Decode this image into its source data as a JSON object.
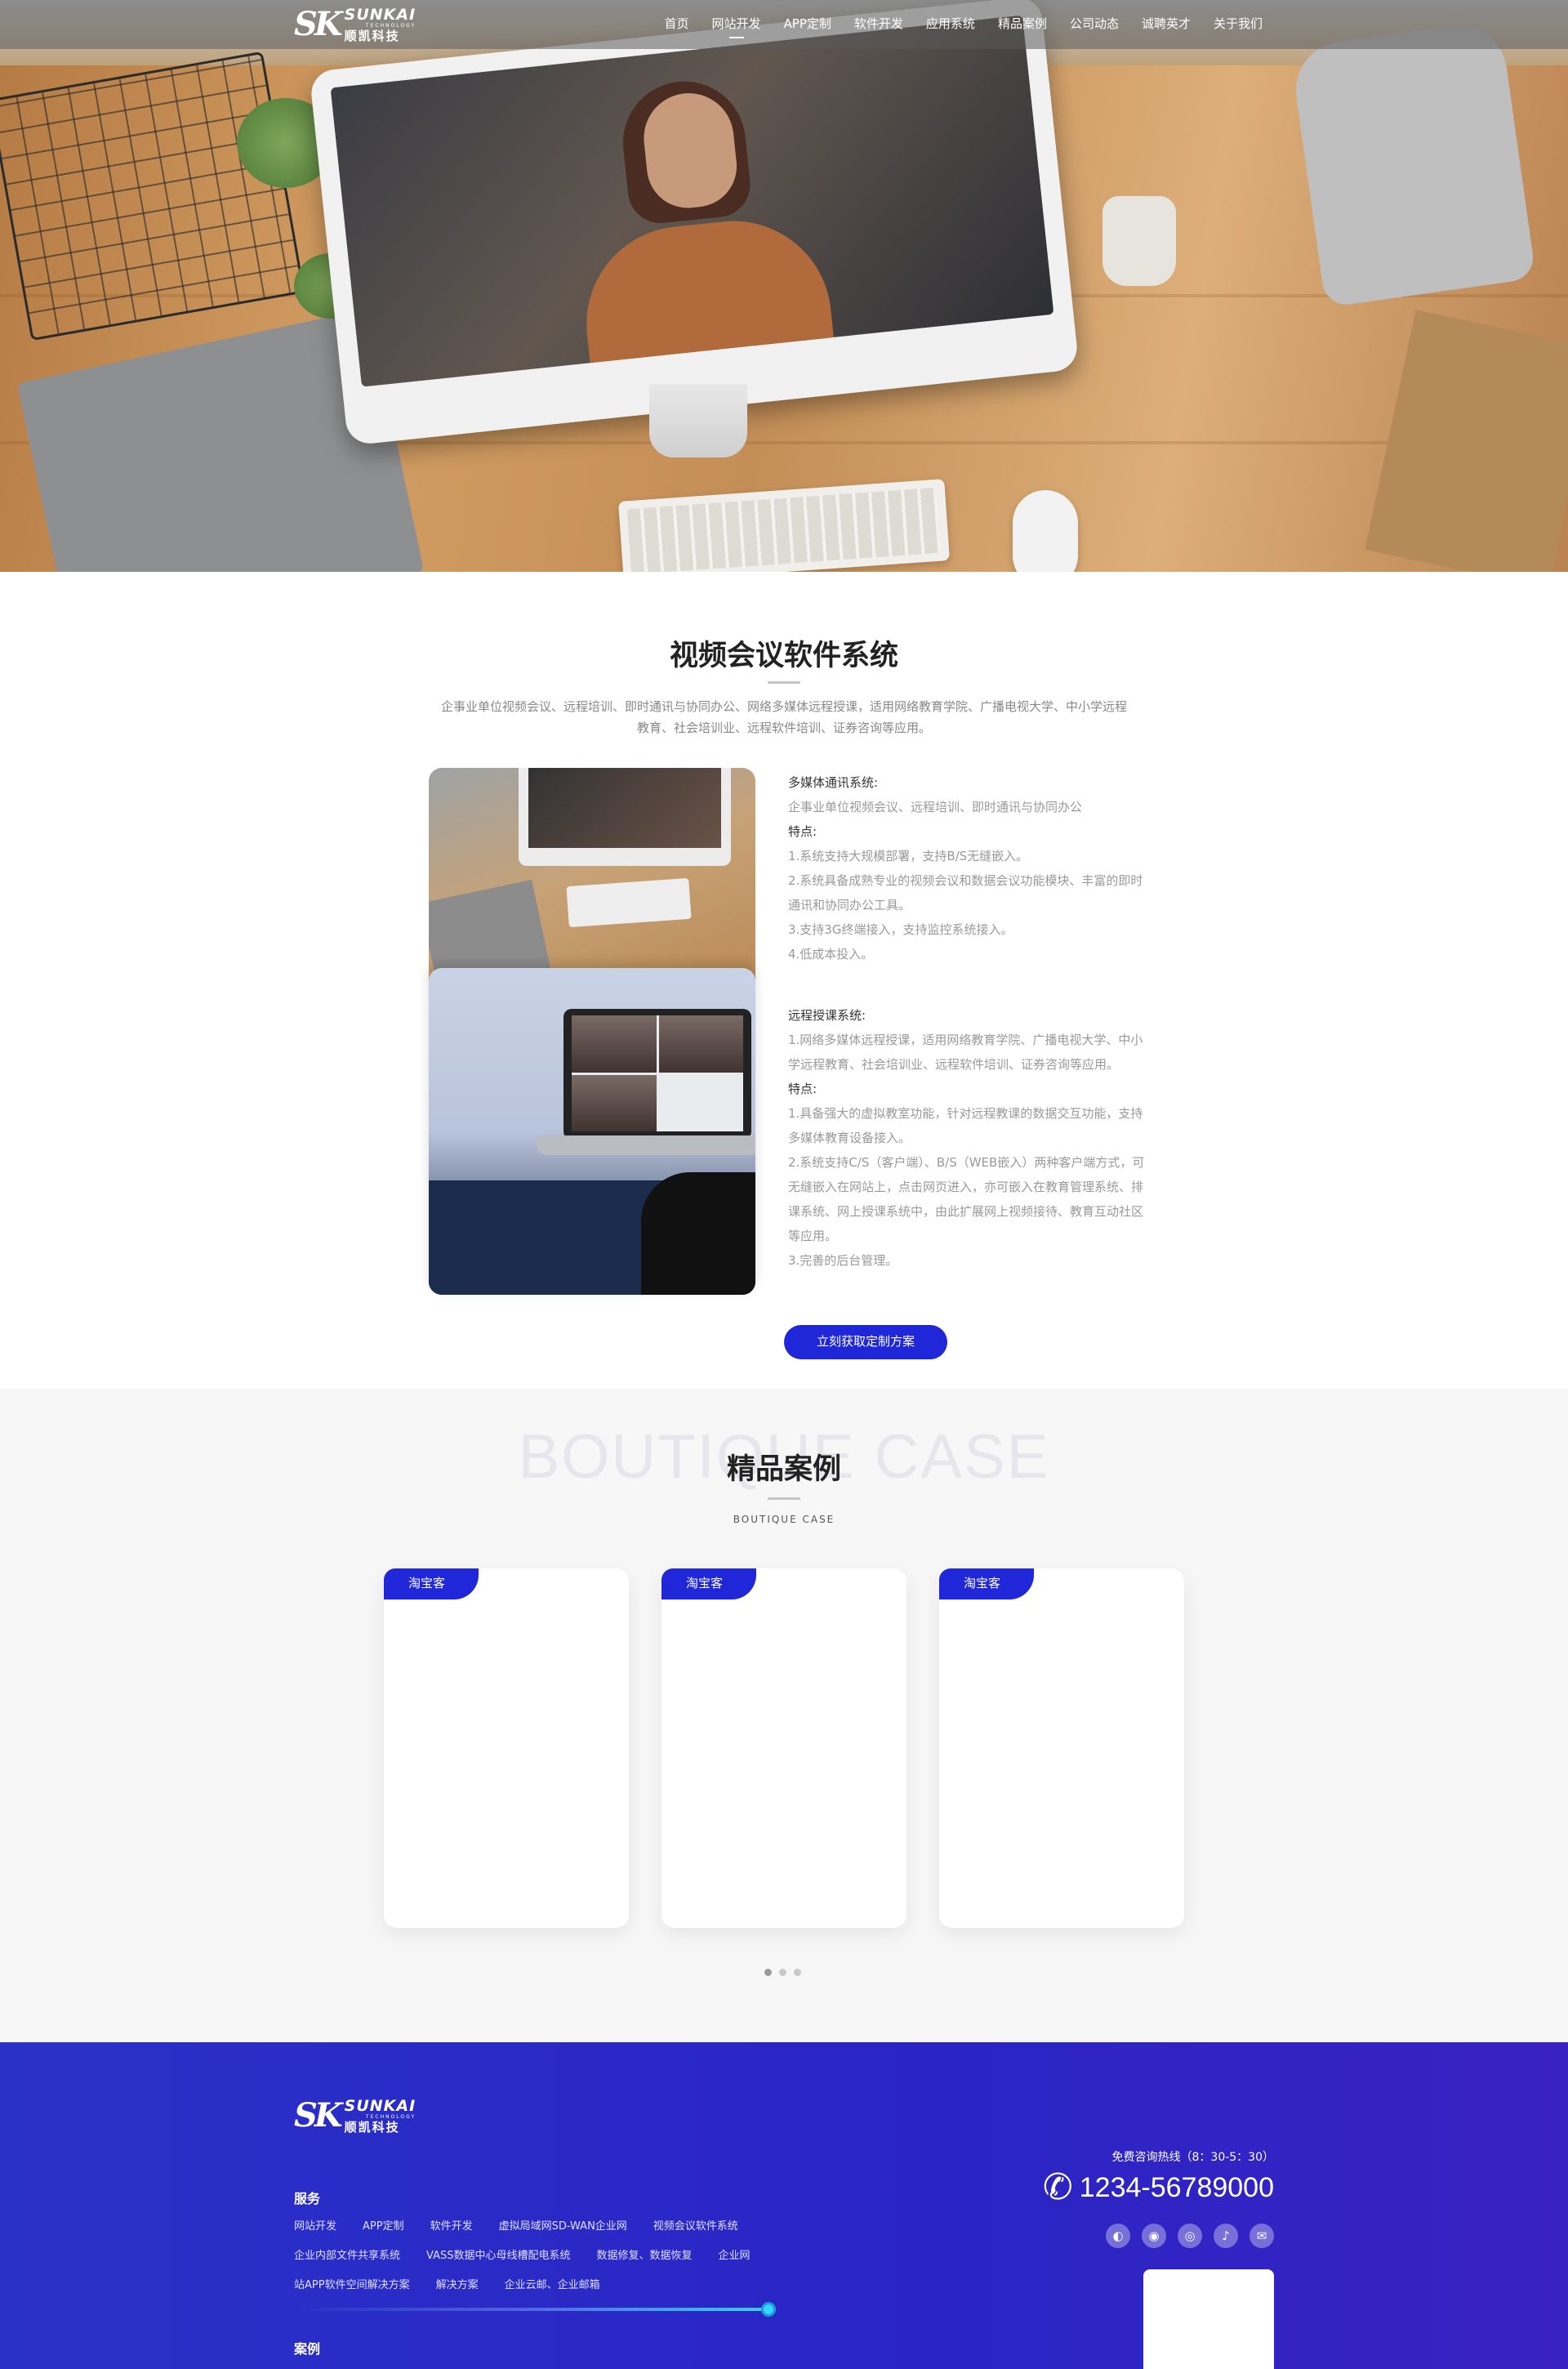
{
  "brand": {
    "mark": "SK",
    "name_en": "SUNKAI",
    "tagline": "TECHNOLOGY",
    "name_cn": "顺凯科技"
  },
  "nav": {
    "items": [
      {
        "label": "首页",
        "active": false
      },
      {
        "label": "网站开发",
        "active": true
      },
      {
        "label": "APP定制",
        "active": false
      },
      {
        "label": "软件开发",
        "active": false
      },
      {
        "label": "应用系统",
        "active": false
      },
      {
        "label": "精品案例",
        "active": false
      },
      {
        "label": "公司动态",
        "active": false
      },
      {
        "label": "诚聘英才",
        "active": false
      },
      {
        "label": "关于我们",
        "active": false
      }
    ]
  },
  "intro": {
    "title": "视频会议软件系统",
    "desc": "企事业单位视频会议、远程培训、即时通讯与协同办公、网络多媒体远程授课，适用网络教育学院、广播电视大学、中小学远程教育、社会培训业、远程软件培训、证券咨询等应用。",
    "block1": {
      "heading": "多媒体通讯系统:",
      "summary": "企事业单位视频会议、远程培训、即时通讯与协同办公",
      "features_label": "特点:",
      "features": [
        "1.系统支持大规模部署，支持B/S无缝嵌入。",
        " 2.系统具备成熟专业的视频会议和数据会议功能模块、丰富的即时通讯和协同办公工具。",
        "3.支持3G终端接入，支持监控系统接入。",
        "4.低成本投入。"
      ]
    },
    "block2": {
      "heading": "远程授课系统:",
      "summary": " 1.网络多媒体远程授课，适用网络教育学院、广播电视大学、中小学远程教育、社会培训业、远程软件培训、证券咨询等应用。",
      "features_label": "特点:",
      "features": [
        "1.具备强大的虚拟教室功能，针对远程教课的数据交互功能，支持多媒体教育设备接入。",
        "2.系统支持C/S（客户端）、B/S（WEB嵌入）两种客户端方式，可无缝嵌入在网站上，点击网页进入，亦可嵌入在教育管理系统、排课系统、网上授课系统中，由此扩展网上视频接待、教育互动社区等应用。",
        "3.完善的后台管理。"
      ]
    },
    "cta": "立刻获取定制方案"
  },
  "cases": {
    "ghost": "BOUTIQUE CASE",
    "title": "精品案例",
    "subtitle": "BOUTIQUE CASE",
    "cards": [
      {
        "tag": "淘宝客"
      },
      {
        "tag": "淘宝客"
      },
      {
        "tag": "淘宝客"
      }
    ],
    "pagination": {
      "count": 3,
      "active_index": 0
    }
  },
  "footer": {
    "services_heading": "服务",
    "services": [
      "网站开发",
      "APP定制",
      "软件开发",
      "虚拟局域网SD-WAN企业网",
      "视频会议软件系统",
      "企业内部文件共享系统",
      "VASS数据中心母线槽配电系统",
      "数据修复、数据恢复",
      "企业网",
      "站APP软件空间解决方案",
      "解决方案",
      "企业云邮、企业邮箱"
    ],
    "cases_heading": "案例",
    "hotline_label": "免费咨询热线（8：30-5：30）",
    "hotline": "1234-56789000",
    "social": [
      {
        "icon": "wechat-icon",
        "glyph": "◐"
      },
      {
        "icon": "qq-icon",
        "glyph": "◉"
      },
      {
        "icon": "weibo-icon",
        "glyph": "◎"
      },
      {
        "icon": "douyin-icon",
        "glyph": "♪"
      },
      {
        "icon": "email-icon",
        "glyph": "✉"
      }
    ],
    "accent": "#2a31c8"
  },
  "colors": {
    "primary": "#1f27d8",
    "footer_bg": "#2a31c8",
    "knob": "#33d6ff"
  }
}
